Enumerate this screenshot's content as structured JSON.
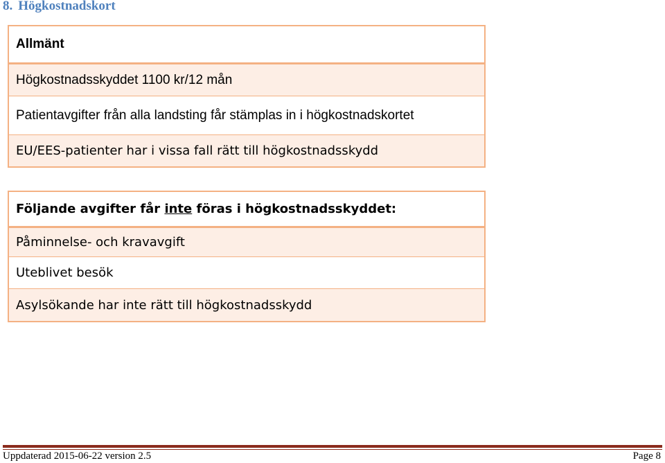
{
  "heading": {
    "number": "8.",
    "title": "Högkostnadskort"
  },
  "table1": {
    "header": "Allmänt",
    "rows": [
      "Högkostnadsskyddet 1100 kr/12 mån",
      "Patientavgifter från alla landsting får stämplas in i högkostnadskortet",
      "EU/EES-patienter har i vissa fall rätt till högkostnadsskydd"
    ]
  },
  "table2": {
    "header_prefix": "Följande avgifter får ",
    "header_underlined": "inte",
    "header_suffix": " föras i högkostnadsskyddet:",
    "rows": [
      "Påminnelse- och kravavgift",
      "Uteblivet besök",
      "Asylsökande har inte rätt till högkostnadsskydd"
    ]
  },
  "footer": {
    "left": "Uppdaterad 2015-06-22 version 2.5",
    "right": "Page 8"
  },
  "colors": {
    "heading": "#4f81bd",
    "border": "#f4b183",
    "shade": "#fdeee5",
    "footer_rule": "#8b2b1d"
  }
}
